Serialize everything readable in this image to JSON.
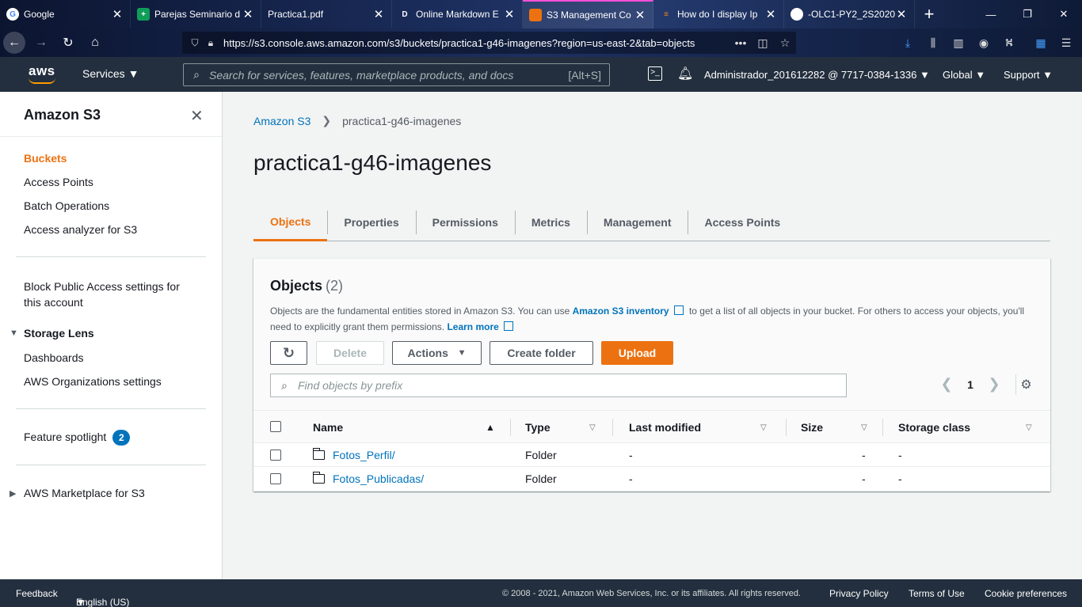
{
  "browser": {
    "tabs": [
      {
        "title": "Google",
        "favicon": "G",
        "favicon_color": "#ffffff"
      },
      {
        "title": "Parejas Seminario d",
        "favicon": "+",
        "favicon_color": "#0f9d58"
      },
      {
        "title": "Practica1.pdf",
        "favicon": "",
        "favicon_color": ""
      },
      {
        "title": "Online Markdown E",
        "favicon": "D",
        "favicon_color": ""
      },
      {
        "title": "S3 Management Co",
        "favicon": "",
        "favicon_color": "#ec7211"
      },
      {
        "title": "How do I display Ip",
        "favicon": "",
        "favicon_color": "#f48024"
      },
      {
        "title": "-OLC1-PY2_2S2020",
        "favicon": "",
        "favicon_color": "#ffffff"
      }
    ],
    "url": "https://s3.console.aws.amazon.com/s3/buckets/practica1-g46-imagenes?region=us-east-2&tab=objects"
  },
  "aws_header": {
    "logo": "aws",
    "services": "Services",
    "search_placeholder": "Search for services, features, marketplace products, and docs",
    "search_shortcut": "[Alt+S]",
    "account": "Administrador_201612282 @ 7717-0384-1336",
    "region": "Global",
    "support": "Support"
  },
  "sidebar": {
    "title": "Amazon S3",
    "items": [
      "Buckets",
      "Access Points",
      "Batch Operations",
      "Access analyzer for S3"
    ],
    "block_public": "Block Public Access settings for this account",
    "storage_lens": "Storage Lens",
    "storage_lens_items": [
      "Dashboards",
      "AWS Organizations settings"
    ],
    "feature_spotlight": "Feature spotlight",
    "feature_spotlight_count": "2",
    "marketplace": "AWS Marketplace for S3"
  },
  "main": {
    "breadcrumb_root": "Amazon S3",
    "breadcrumb_current": "practica1-g46-imagenes",
    "title": "practica1-g46-imagenes",
    "tabs": [
      "Objects",
      "Properties",
      "Permissions",
      "Metrics",
      "Management",
      "Access Points"
    ],
    "objects": {
      "title": "Objects",
      "count": "(2)",
      "desc_1": "Objects are the fundamental entities stored in Amazon S3. You can use ",
      "desc_link_1": "Amazon S3 inventory",
      "desc_2": " to get a list of all objects in your bucket. For others to access your objects, you'll need to explicitly grant them permissions. ",
      "desc_link_2": "Learn more",
      "buttons": {
        "delete": "Delete",
        "actions": "Actions",
        "create_folder": "Create folder",
        "upload": "Upload"
      },
      "filter_placeholder": "Find objects by prefix",
      "page": "1",
      "columns": [
        "Name",
        "Type",
        "Last modified",
        "Size",
        "Storage class"
      ],
      "rows": [
        {
          "name": "Fotos_Perfil/",
          "type": "Folder",
          "modified": "-",
          "size": "-",
          "storage": "-"
        },
        {
          "name": "Fotos_Publicadas/",
          "type": "Folder",
          "modified": "-",
          "size": "-",
          "storage": "-"
        }
      ]
    }
  },
  "footer": {
    "feedback": "Feedback",
    "language": "English (US)",
    "copyright": "© 2008 - 2021, Amazon Web Services, Inc. or its affiliates. All rights reserved.",
    "privacy": "Privacy Policy",
    "terms": "Terms of Use",
    "cookies": "Cookie preferences"
  },
  "colors": {
    "accent": "#ec7211",
    "link": "#0073bb",
    "header": "#232f3e"
  }
}
